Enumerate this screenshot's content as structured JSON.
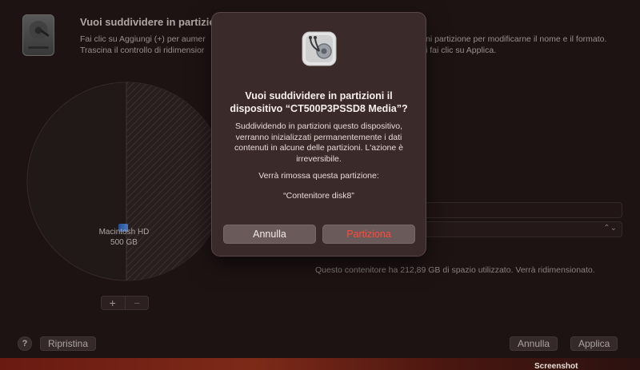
{
  "background": {
    "title": "Vuoi suddividere in partizioni",
    "desc_left_line1": "Fai clic su Aggiungi (+) per aumer",
    "desc_left_line2": "Trascina il controllo di ridimensior",
    "desc_right_line1": "ni partizione per modificarne il nome e il formato.",
    "desc_right_line2": "i fai clic su Applica.",
    "pie_volume_name": "Macintosh HD",
    "pie_volume_size": "500 GB",
    "add_label": "+",
    "remove_label": "−",
    "info_text": "Questo contenitore ha 212,89 GB di spazio utilizzato. Verrà ridimensionato.",
    "select_arrow": "⌃⌄",
    "help_label": "?",
    "revert_label": "Ripristina",
    "cancel_label": "Annulla",
    "apply_label": "Applica"
  },
  "modal": {
    "title": "Vuoi suddividere in partizioni il dispositivo “CT500P3PSSD8 Media”?",
    "body": "Suddividendo in partizioni questo dispositivo, verranno inizializzati permanentemente i dati contenuti in alcune delle partizioni. L'azione è irreversibile.",
    "note": "Verrà rimossa questa partizione:",
    "partition": "“Contenitore disk8”",
    "cancel_label": "Annulla",
    "confirm_label": "Partiziona"
  },
  "desktop": {
    "screenshot_label": "Screenshot"
  },
  "colors": {
    "destructive": "#ff4a3d",
    "sheet": "#2a1b1b",
    "modal": "#3b2a2a"
  },
  "icons": {
    "app": "disk-utility-stethoscope-icon",
    "disk": "hard-disk-icon",
    "volume": "finder-volume-icon",
    "help": "help-icon"
  }
}
